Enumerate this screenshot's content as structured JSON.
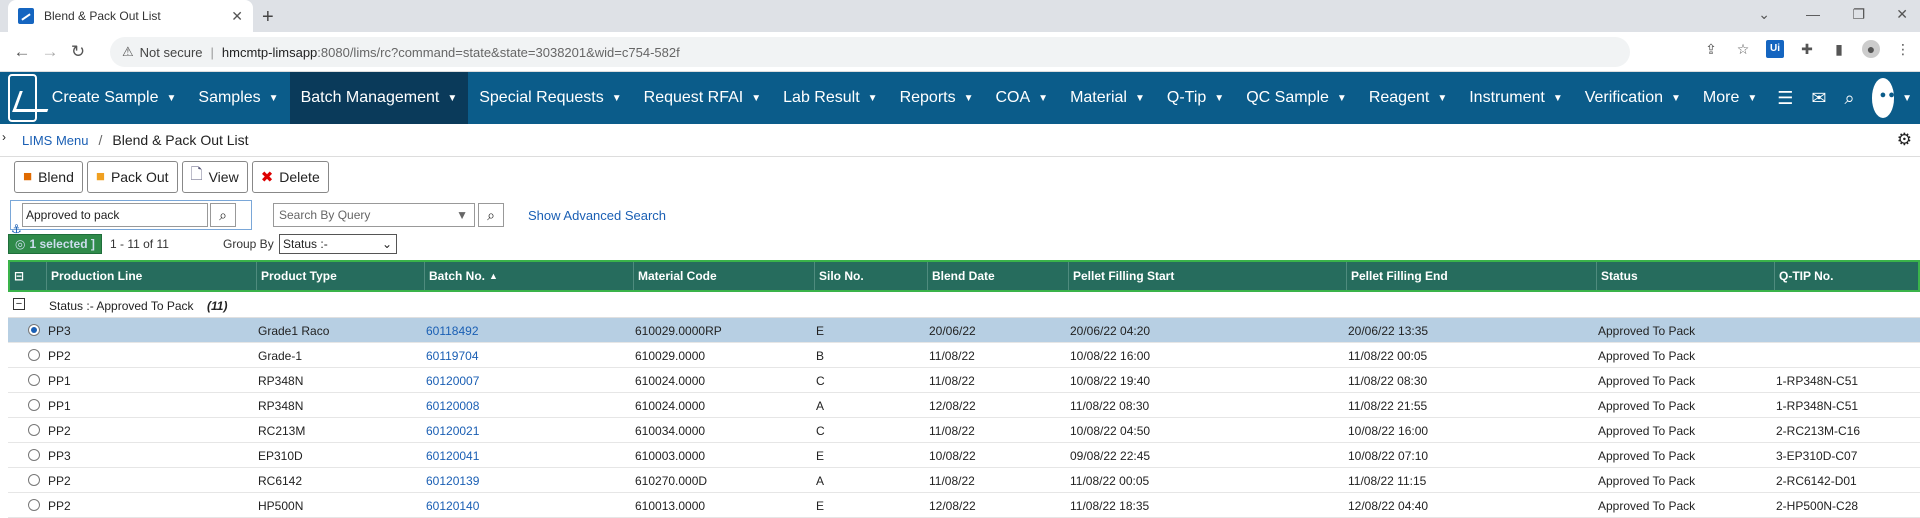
{
  "browser": {
    "tab_title": "Blend & Pack Out List",
    "url_warning": "Not secure",
    "url_host": "hmcmtp-limsapp",
    "url_rest": ":8080/lims/rc?command=state&state=3038201&wid=c754-582f"
  },
  "nav": {
    "items": [
      {
        "label": "Create Sample"
      },
      {
        "label": "Samples"
      },
      {
        "label": "Batch Management"
      },
      {
        "label": "Special Requests"
      },
      {
        "label": "Request RFAI"
      },
      {
        "label": "Lab Result"
      },
      {
        "label": "Reports"
      },
      {
        "label": "COA"
      },
      {
        "label": "Material"
      },
      {
        "label": "Q-Tip"
      },
      {
        "label": "QC Sample"
      },
      {
        "label": "Reagent"
      },
      {
        "label": "Instrument"
      },
      {
        "label": "Verification"
      },
      {
        "label": "More"
      }
    ]
  },
  "breadcrumb": {
    "root": "LIMS Menu",
    "current": "Blend & Pack Out List"
  },
  "toolbar": {
    "blend": "Blend",
    "pack_out": "Pack Out",
    "view": "View",
    "delete": "Delete"
  },
  "search": {
    "value": "Approved to pack",
    "query_placeholder": "Search By Query",
    "advanced": "Show Advanced Search"
  },
  "grouping": {
    "selected": "1 selected ]",
    "count": "1 - 11 of 11",
    "group_by_label": "Group By",
    "group_by_value": "Status :-"
  },
  "table": {
    "columns": [
      "Production Line",
      "Product Type",
      "Batch No.",
      "Material Code",
      "Silo No.",
      "Blend Date",
      "Pellet Filling Start",
      "Pellet Filling End",
      "Status",
      "Q-TIP No."
    ],
    "group_label": "Status :- Approved To Pack",
    "group_count": "(11)",
    "rows": [
      [
        "PP3",
        "Grade1 Raco",
        "60118492",
        "610029.0000RP",
        "E",
        "20/06/22",
        "20/06/22 04:20",
        "20/06/22 13:35",
        "Approved To Pack",
        ""
      ],
      [
        "PP2",
        "Grade-1",
        "60119704",
        "610029.0000",
        "B",
        "11/08/22",
        "10/08/22 16:00",
        "11/08/22 00:05",
        "Approved To Pack",
        ""
      ],
      [
        "PP1",
        "RP348N",
        "60120007",
        "610024.0000",
        "C",
        "11/08/22",
        "10/08/22 19:40",
        "11/08/22 08:30",
        "Approved To Pack",
        "1-RP348N-C51"
      ],
      [
        "PP1",
        "RP348N",
        "60120008",
        "610024.0000",
        "A",
        "12/08/22",
        "11/08/22 08:30",
        "11/08/22 21:55",
        "Approved To Pack",
        "1-RP348N-C51"
      ],
      [
        "PP2",
        "RC213M",
        "60120021",
        "610034.0000",
        "C",
        "11/08/22",
        "10/08/22 04:50",
        "10/08/22 16:00",
        "Approved To Pack",
        "2-RC213M-C16"
      ],
      [
        "PP3",
        "EP310D",
        "60120041",
        "610003.0000",
        "E",
        "10/08/22",
        "09/08/22 22:45",
        "10/08/22 07:10",
        "Approved To Pack",
        "3-EP310D-C07"
      ],
      [
        "PP2",
        "RC6142",
        "60120139",
        "610270.000D",
        "A",
        "11/08/22",
        "11/08/22 00:05",
        "11/08/22 11:15",
        "Approved To Pack",
        "2-RC6142-D01"
      ],
      [
        "PP2",
        "HP500N",
        "60120140",
        "610013.0000",
        "E",
        "12/08/22",
        "11/08/22 18:35",
        "12/08/22 04:40",
        "Approved To Pack",
        "2-HP500N-C28"
      ]
    ]
  }
}
